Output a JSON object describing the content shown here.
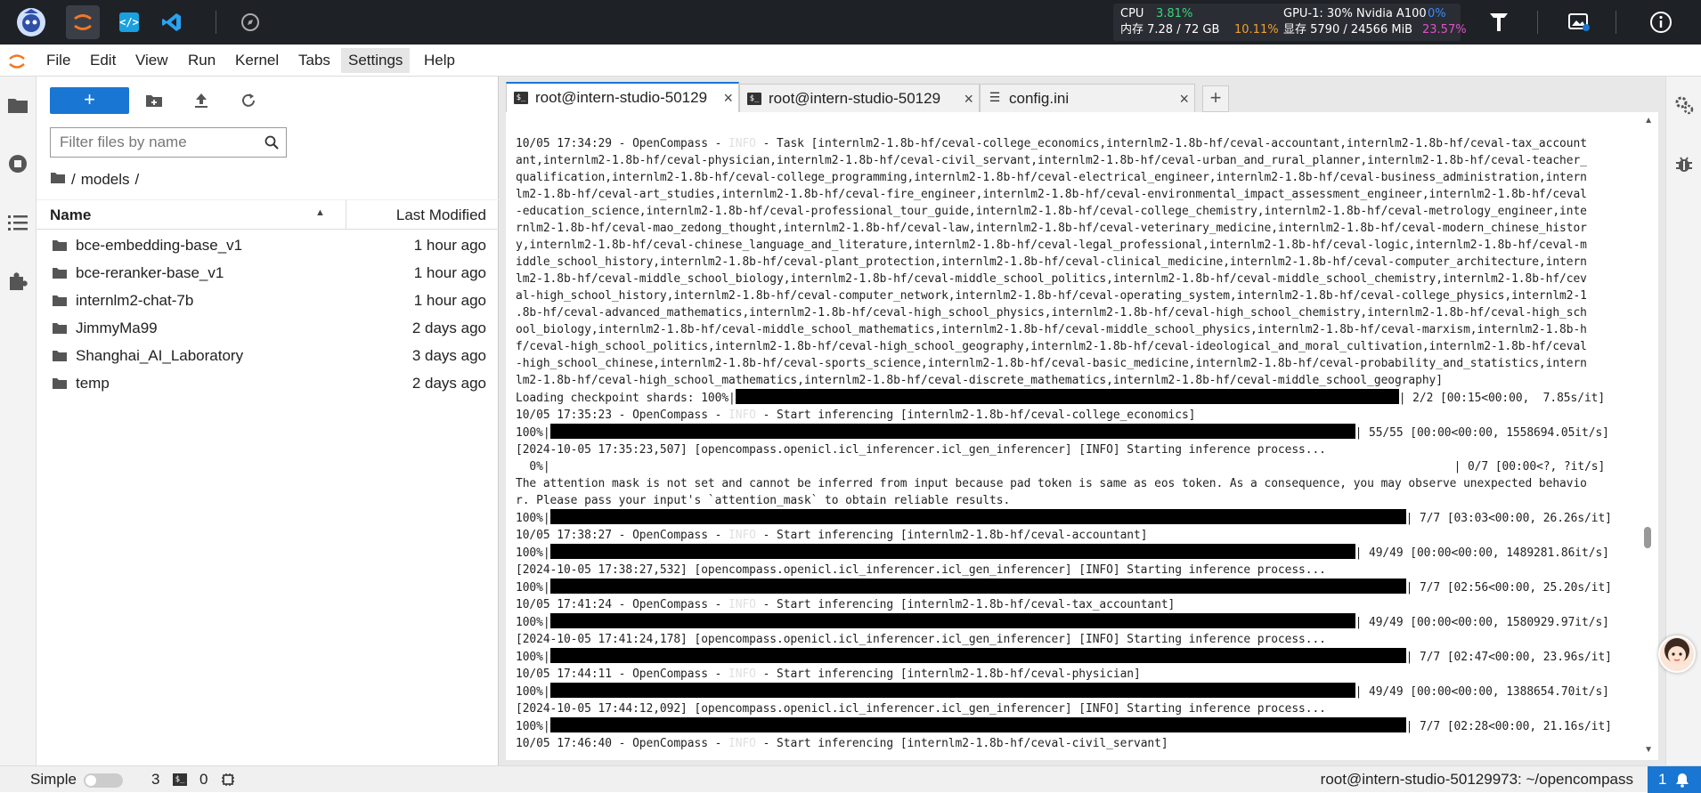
{
  "topbar": {
    "cpu_label": "CPU",
    "cpu_value": "3.81%",
    "mem_label": "内存 7.28 / 72 GB",
    "mem_value": "10.11%",
    "gpu_label": "GPU-1: 30% Nvidia A100",
    "gpu_value": "0%",
    "vram_label": "显存 5790 / 24566 MiB",
    "vram_value": "23.57%"
  },
  "menu": [
    "File",
    "Edit",
    "View",
    "Run",
    "Kernel",
    "Tabs",
    "Settings",
    "Help"
  ],
  "filebrowser": {
    "new_label": "+",
    "filter_placeholder": "Filter files by name",
    "breadcrumb_root": "/",
    "breadcrumb_folder": "models",
    "breadcrumb_tail": "/",
    "col_name": "Name",
    "col_modified": "Last Modified",
    "files": [
      {
        "name": "bce-embedding-base_v1",
        "modified": "1 hour ago"
      },
      {
        "name": "bce-reranker-base_v1",
        "modified": "1 hour ago"
      },
      {
        "name": "internlm2-chat-7b",
        "modified": "1 hour ago"
      },
      {
        "name": "JimmyMa99",
        "modified": "2 days ago"
      },
      {
        "name": "Shanghai_AI_Laboratory",
        "modified": "3 days ago"
      },
      {
        "name": "temp",
        "modified": "2 days ago"
      }
    ]
  },
  "tabs": [
    {
      "label": "root@intern-studio-50129",
      "close": "×"
    },
    {
      "label": "root@intern-studio-50129",
      "close": "×"
    },
    {
      "label": "config.ini",
      "close": "×"
    }
  ],
  "add_tab": "+",
  "terminal": {
    "task_prefix": "10/05 17:34:29 - OpenCompass - ",
    "info": "INFO",
    "task_lines": [
      " - Task [internlm2-1.8b-hf/ceval-college_economics,internlm2-1.8b-hf/ceval-accountant,internlm2-1.8b-hf/ceval-tax_account",
      "ant,internlm2-1.8b-hf/ceval-physician,internlm2-1.8b-hf/ceval-civil_servant,internlm2-1.8b-hf/ceval-urban_and_rural_planner,internlm2-1.8b-hf/ceval-teacher_",
      "qualification,internlm2-1.8b-hf/ceval-college_programming,internlm2-1.8b-hf/ceval-electrical_engineer,internlm2-1.8b-hf/ceval-business_administration,intern",
      "lm2-1.8b-hf/ceval-art_studies,internlm2-1.8b-hf/ceval-fire_engineer,internlm2-1.8b-hf/ceval-environmental_impact_assessment_engineer,internlm2-1.8b-hf/ceval",
      "-education_science,internlm2-1.8b-hf/ceval-professional_tour_guide,internlm2-1.8b-hf/ceval-college_chemistry,internlm2-1.8b-hf/ceval-metrology_engineer,inte",
      "rnlm2-1.8b-hf/ceval-mao_zedong_thought,internlm2-1.8b-hf/ceval-law,internlm2-1.8b-hf/ceval-veterinary_medicine,internlm2-1.8b-hf/ceval-modern_chinese_histor",
      "y,internlm2-1.8b-hf/ceval-chinese_language_and_literature,internlm2-1.8b-hf/ceval-legal_professional,internlm2-1.8b-hf/ceval-logic,internlm2-1.8b-hf/ceval-m",
      "iddle_school_history,internlm2-1.8b-hf/ceval-plant_protection,internlm2-1.8b-hf/ceval-clinical_medicine,internlm2-1.8b-hf/ceval-computer_architecture,intern",
      "lm2-1.8b-hf/ceval-middle_school_biology,internlm2-1.8b-hf/ceval-middle_school_politics,internlm2-1.8b-hf/ceval-middle_school_chemistry,internlm2-1.8b-hf/cev",
      "al-high_school_history,internlm2-1.8b-hf/ceval-computer_network,internlm2-1.8b-hf/ceval-operating_system,internlm2-1.8b-hf/ceval-college_physics,internlm2-1",
      ".8b-hf/ceval-advanced_mathematics,internlm2-1.8b-hf/ceval-high_school_physics,internlm2-1.8b-hf/ceval-high_school_chemistry,internlm2-1.8b-hf/ceval-high_sch",
      "ool_biology,internlm2-1.8b-hf/ceval-middle_school_mathematics,internlm2-1.8b-hf/ceval-middle_school_physics,internlm2-1.8b-hf/ceval-marxism,internlm2-1.8b-h",
      "f/ceval-high_school_politics,internlm2-1.8b-hf/ceval-high_school_geography,internlm2-1.8b-hf/ceval-ideological_and_moral_cultivation,internlm2-1.8b-hf/ceval",
      "-high_school_chinese,internlm2-1.8b-hf/ceval-sports_science,internlm2-1.8b-hf/ceval-basic_medicine,internlm2-1.8b-hf/ceval-probability_and_statistics,intern",
      "lm2-1.8b-hf/ceval-high_school_mathematics,internlm2-1.8b-hf/ceval-discrete_mathematics,internlm2-1.8b-hf/ceval-middle_school_geography]"
    ],
    "loading_prefix": "Loading checkpoint shards: 100%|",
    "loading_suffix": "| 2/2 [00:15<00:00,  7.85s/it]",
    "start1_prefix": "10/05 17:35:23 - OpenCompass - ",
    "start1_suffix": " - Start inferencing [internlm2-1.8b-hf/ceval-college_economics]",
    "p1_prefix": "100%|",
    "p1_suffix": "| 55/55 [00:00<00:00, 1558694.05it/s]",
    "infer1": "[2024-10-05 17:35:23,507] [opencompass.openicl.icl_inferencer.icl_gen_inferencer] [INFO] Starting inference process...",
    "p0_prefix": "  0%|",
    "p0_suffix": "| 0/7 [00:00<?, ?it/s]",
    "attn1": "The attention mask is not set and cannot be inferred from input because pad token is same as eos token. As a consequence, you may observe unexpected behavio",
    "attn2": "r. Please pass your input's `attention_mask` to obtain reliable results.",
    "p2_prefix": "100%|",
    "p2_suffix": "| 7/7 [03:03<00:00, 26.26s/it]",
    "start2_prefix": "10/05 17:38:27 - OpenCompass - ",
    "start2_suffix": " - Start inferencing [internlm2-1.8b-hf/ceval-accountant]",
    "p3_prefix": "100%|",
    "p3_suffix": "| 49/49 [00:00<00:00, 1489281.86it/s]",
    "infer2": "[2024-10-05 17:38:27,532] [opencompass.openicl.icl_inferencer.icl_gen_inferencer] [INFO] Starting inference process...",
    "p4_prefix": "100%|",
    "p4_suffix": "| 7/7 [02:56<00:00, 25.20s/it]",
    "start3_prefix": "10/05 17:41:24 - OpenCompass - ",
    "start3_suffix": " - Start inferencing [internlm2-1.8b-hf/ceval-tax_accountant]",
    "p5_prefix": "100%|",
    "p5_suffix": "| 49/49 [00:00<00:00, 1580929.97it/s]",
    "infer3": "[2024-10-05 17:41:24,178] [opencompass.openicl.icl_inferencer.icl_gen_inferencer] [INFO] Starting inference process...",
    "p6_prefix": "100%|",
    "p6_suffix": "| 7/7 [02:47<00:00, 23.96s/it]",
    "start4_prefix": "10/05 17:44:11 - OpenCompass - ",
    "start4_suffix": " - Start inferencing [internlm2-1.8b-hf/ceval-physician]",
    "p7_prefix": "100%|",
    "p7_suffix": "| 49/49 [00:00<00:00, 1388654.70it/s]",
    "infer4": "[2024-10-05 17:44:12,092] [opencompass.openicl.icl_inferencer.icl_gen_inferencer] [INFO] Starting inference process...",
    "p8_prefix": "100%|",
    "p8_suffix": "| 7/7 [02:28<00:00, 21.16s/it]",
    "start5_prefix": "10/05 17:46:40 - OpenCompass - ",
    "start5_suffix": " - Start inferencing [internlm2-1.8b-hf/ceval-civil_servant]"
  },
  "statusbar": {
    "mode": "Simple",
    "kernels": "3",
    "terminals": "0",
    "path": "root@intern-studio-50129973: ~/opencompass",
    "notifications": "1"
  },
  "colors": {
    "accent": "#1976d2",
    "topbar": "#1e2126",
    "jupyter_orange": "#f37726"
  }
}
